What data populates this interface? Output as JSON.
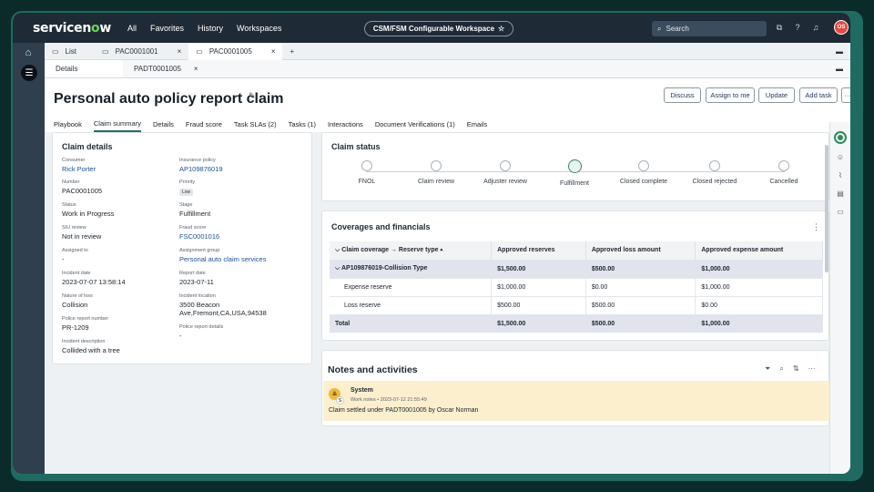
{
  "topbar": {
    "logo_text_a": "servicen",
    "logo_text_o": "o",
    "logo_text_b": "w",
    "nav": [
      "All",
      "Favorites",
      "History",
      "Workspaces"
    ],
    "workspace_label": "CSM/FSM Configurable Workspace",
    "search_placeholder": "Search",
    "avatar_initials": "OS"
  },
  "tabs": {
    "list_label": "List",
    "records": [
      "PAC0001001",
      "PAC0001005"
    ]
  },
  "subtabs": {
    "details_label": "Details",
    "child_tab": "PADT0001005"
  },
  "header": {
    "title": "Personal auto policy report claim",
    "actions": [
      "Discuss",
      "Assign to me",
      "Update",
      "Add task"
    ],
    "more_label": "···"
  },
  "navtabs": [
    "Playbook",
    "Claim summary",
    "Details",
    "Fraud score",
    "Task SLAs (2)",
    "Tasks (1)",
    "Interactions",
    "Document Verifications (1)",
    "Emails"
  ],
  "claim_details": {
    "title": "Claim details",
    "fields": [
      {
        "label": "Consumer",
        "value": "Rick Porter",
        "link": true
      },
      {
        "label": "Insurance policy",
        "value": "AP109876019",
        "link": true
      },
      {
        "label": "Number",
        "value": "PAC0001005",
        "link": false
      },
      {
        "label": "Priority",
        "value": "Low",
        "badge": true
      },
      {
        "label": "Status",
        "value": "Work in Progress",
        "link": false
      },
      {
        "label": "Stage",
        "value": "Fulfillment",
        "link": false
      },
      {
        "label": "SIU review",
        "value": "Not in review",
        "link": false
      },
      {
        "label": "Fraud score",
        "value": "FSC0001016",
        "link": true
      },
      {
        "label": "Assigned to",
        "value": "-",
        "link": false
      },
      {
        "label": "Assignment group",
        "value": "Personal auto claim services",
        "link": true
      },
      {
        "label": "Incident date",
        "value": "2023-07-07 13:58:14",
        "link": false
      },
      {
        "label": "Report date",
        "value": "2023-07-11",
        "link": false
      },
      {
        "label": "Nature of loss",
        "value": "Collision",
        "link": false
      },
      {
        "label": "Incident location",
        "value": "3500 Beacon Ave,Fremont,CA,USA,94538",
        "link": false
      },
      {
        "label": "Police report number",
        "value": "PR-1209",
        "link": false
      },
      {
        "label": "Police report details",
        "value": "-",
        "link": false
      },
      {
        "label": "Incident description",
        "value": "Collided with a tree",
        "link": false
      }
    ]
  },
  "claim_status": {
    "title": "Claim status",
    "stages": [
      "FNOL",
      "Claim review",
      "Adjuster review",
      "Fulfillment",
      "Closed complete",
      "Closed rejected",
      "Cancelled"
    ],
    "current_stage": "Fulfillment"
  },
  "coverages": {
    "title": "Coverages and financials",
    "columns": [
      "Claim coverage → Reserve type ▴",
      "Approved reserves",
      "Approved loss amount",
      "Approved expense amount"
    ],
    "rows": [
      {
        "kind": "grp",
        "cells": [
          "AP109876019-Collision Type",
          "$1,500.00",
          "$500.00",
          "$1,000.00"
        ]
      },
      {
        "kind": "item",
        "cells": [
          "Expense reserve",
          "$1,000.00",
          "$0.00",
          "$1,000.00"
        ]
      },
      {
        "kind": "item",
        "cells": [
          "Loss reserve",
          "$500.00",
          "$500.00",
          "$0.00"
        ]
      },
      {
        "kind": "tot",
        "cells": [
          "Total",
          "$1,500.00",
          "$500.00",
          "$1,000.00"
        ]
      }
    ]
  },
  "notes": {
    "title": "Notes and activities",
    "entry": {
      "author": "System",
      "meta": "Work notes • 2023-07-12 21:55:49",
      "text": "Claim settled under PADT0001005 by Oscar Norman",
      "avatar_letter": "S"
    }
  },
  "colors": {
    "topbar": "#1e2a36",
    "accent": "#2b6e66",
    "link": "#1f4f9c",
    "note_bg": "#fbefce",
    "table_highlight": "#e1e3ef"
  }
}
